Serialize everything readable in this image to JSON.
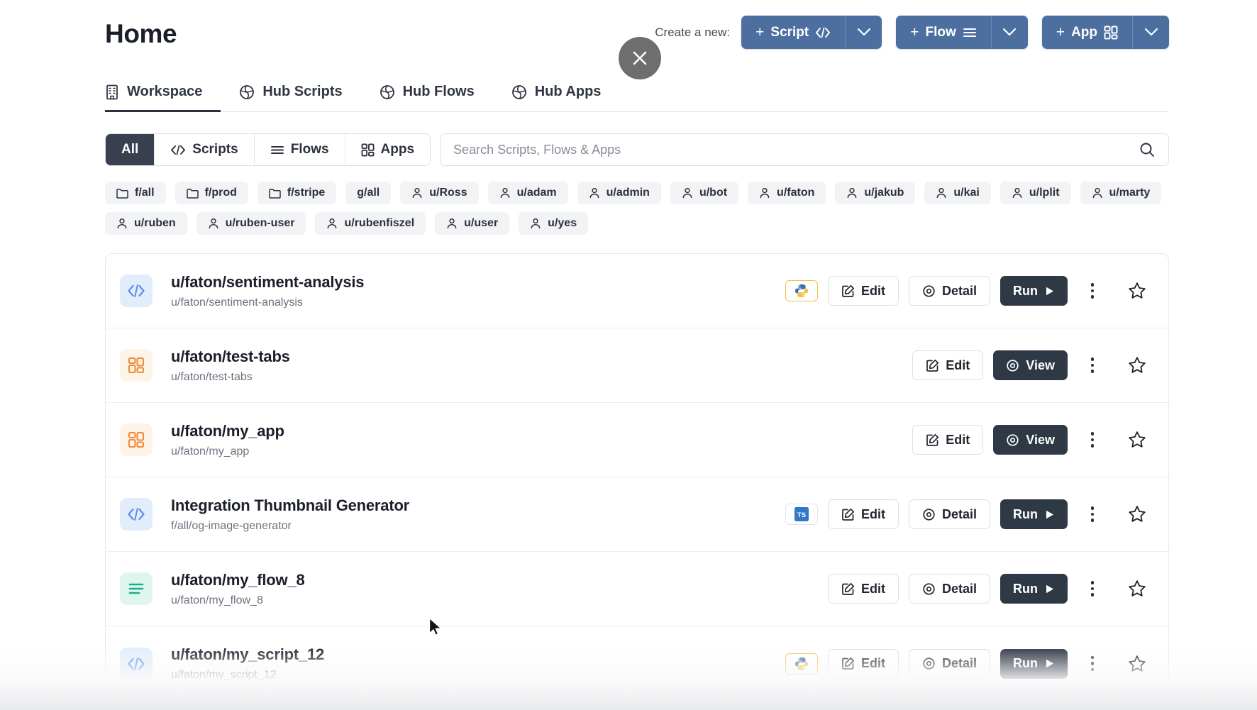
{
  "header": {
    "title": "Home",
    "create_label": "Create a new:",
    "close_overlay": "close-button",
    "create_buttons": [
      {
        "label": "Script",
        "icon": "code-icon",
        "plus": "+",
        "caret": "chevron-down-icon"
      },
      {
        "label": "Flow",
        "icon": "flow-icon",
        "plus": "+",
        "caret": "chevron-down-icon"
      },
      {
        "label": "App",
        "icon": "grid-icon",
        "plus": "+",
        "caret": "chevron-down-icon"
      }
    ]
  },
  "tabs": [
    {
      "label": "Workspace",
      "icon": "building-icon",
      "active": true
    },
    {
      "label": "Hub Scripts",
      "icon": "globe-icon",
      "active": false
    },
    {
      "label": "Hub Flows",
      "icon": "globe-icon",
      "active": false
    },
    {
      "label": "Hub Apps",
      "icon": "globe-icon",
      "active": false
    }
  ],
  "filters": {
    "segments": [
      {
        "label": "All",
        "icon": "none",
        "active": true
      },
      {
        "label": "Scripts",
        "icon": "code-icon",
        "active": false
      },
      {
        "label": "Flows",
        "icon": "flow-icon",
        "active": false
      },
      {
        "label": "Apps",
        "icon": "grid-icon",
        "active": false
      }
    ],
    "search": {
      "placeholder": "Search Scripts, Flows & Apps",
      "value": "",
      "icon": "search-icon"
    }
  },
  "chips": [
    {
      "label": "f/all",
      "icon": "folder-icon"
    },
    {
      "label": "f/prod",
      "icon": "folder-icon"
    },
    {
      "label": "f/stripe",
      "icon": "folder-icon"
    },
    {
      "label": "g/all",
      "icon": "none"
    },
    {
      "label": "u/Ross",
      "icon": "user-icon"
    },
    {
      "label": "u/adam",
      "icon": "user-icon"
    },
    {
      "label": "u/admin",
      "icon": "user-icon"
    },
    {
      "label": "u/bot",
      "icon": "user-icon"
    },
    {
      "label": "u/faton",
      "icon": "user-icon"
    },
    {
      "label": "u/jakub",
      "icon": "user-icon"
    },
    {
      "label": "u/kai",
      "icon": "user-icon"
    },
    {
      "label": "u/lplit",
      "icon": "user-icon"
    },
    {
      "label": "u/marty",
      "icon": "user-icon"
    },
    {
      "label": "u/ruben",
      "icon": "user-icon"
    },
    {
      "label": "u/ruben-user",
      "icon": "user-icon"
    },
    {
      "label": "u/rubenfiszel",
      "icon": "user-icon"
    },
    {
      "label": "u/user",
      "icon": "user-icon"
    },
    {
      "label": "u/yes",
      "icon": "user-icon"
    }
  ],
  "action_labels": {
    "edit": "Edit",
    "detail": "Detail",
    "run": "Run",
    "view": "View"
  },
  "rows": [
    {
      "title": "u/faton/sentiment-analysis",
      "path": "u/faton/sentiment-analysis",
      "kind": "script",
      "lang": "python",
      "primary": "Run",
      "secondary": "Detail"
    },
    {
      "title": "u/faton/test-tabs",
      "path": "u/faton/test-tabs",
      "kind": "app",
      "lang": "none",
      "primary": "View",
      "secondary": ""
    },
    {
      "title": "u/faton/my_app",
      "path": "u/faton/my_app",
      "kind": "app",
      "lang": "none",
      "primary": "View",
      "secondary": ""
    },
    {
      "title": "Integration Thumbnail Generator",
      "path": "f/all/og-image-generator",
      "kind": "script",
      "lang": "typescript",
      "primary": "Run",
      "secondary": "Detail"
    },
    {
      "title": "u/faton/my_flow_8",
      "path": "u/faton/my_flow_8",
      "kind": "flow",
      "lang": "none",
      "primary": "Run",
      "secondary": "Detail"
    },
    {
      "title": "u/faton/my_script_12",
      "path": "u/faton/my_script_12",
      "kind": "script",
      "lang": "python",
      "primary": "Run",
      "secondary": "Detail"
    }
  ],
  "colors": {
    "accent_button": "#4d6fa0",
    "dark_button": "#2f3845",
    "script_icon": "#5b8def",
    "app_icon": "#ef8b3c",
    "flow_icon": "#18b08a",
    "chip_bg": "#f2f3f5"
  }
}
